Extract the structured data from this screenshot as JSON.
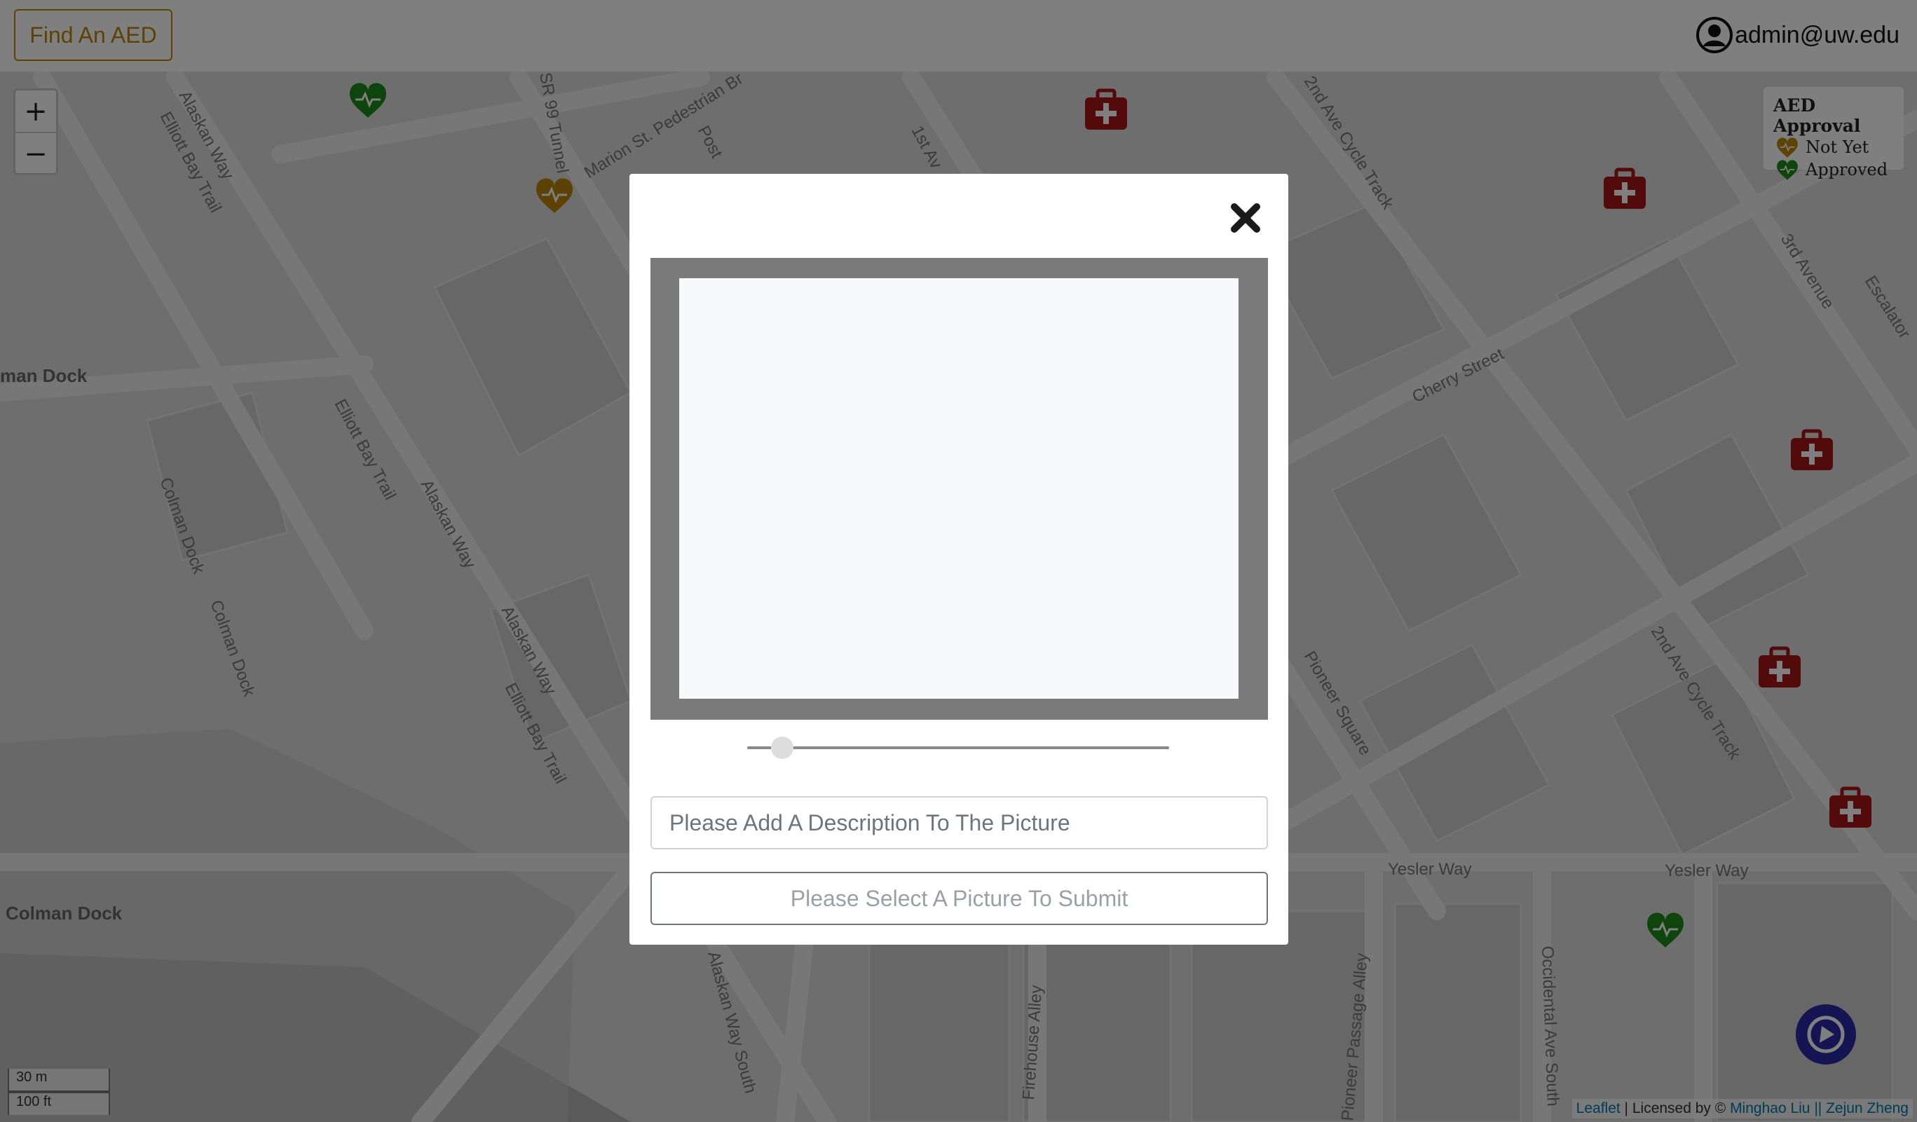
{
  "header": {
    "find_aed_label": "Find An AED",
    "user_email": "admin@uw.edu",
    "user_icon": "user-circle-icon"
  },
  "map": {
    "zoom_in_label": "+",
    "zoom_out_label": "−",
    "street_labels": [
      "Alaskan Way",
      "Elliott Bay Trail",
      "SR 99 Tunnel",
      "Marion St. Pedestrian Br",
      "Post",
      "1st Av",
      "2nd Ave Cycle Track",
      "3rd Avenue",
      "Escalator",
      "Cherry Street",
      "Colman Dock",
      "Yesler Way",
      "Pioneer Square",
      "Pioneer Passage Alley",
      "Occidental Ave South",
      "Firehouse Alley",
      "Alaskan Way South"
    ],
    "dock_labels": [
      "man Dock",
      "Colman Dock"
    ],
    "legend": {
      "title": "AED Approval",
      "items": [
        {
          "label": "Not Yet",
          "icon": "heart-pulse-icon",
          "color": "#b8860b"
        },
        {
          "label": "Approved",
          "icon": "heart-pulse-icon",
          "color": "#1a8a1a"
        }
      ]
    },
    "scale": {
      "metric": "30 m",
      "imperial": "100 ft"
    },
    "attribution": {
      "leaflet": "Leaflet",
      "separator": " | Licensed by © ",
      "author1": "Minghao Liu",
      "joiner": " || ",
      "author2": "Zejun Zheng"
    },
    "marker_colors": {
      "approved": "#1a8a1a",
      "not_yet": "#b8860b",
      "first_aid": "#a41515"
    }
  },
  "modal": {
    "close_icon": "close-icon",
    "slider_value": 0.06,
    "description_placeholder": "Please Add A Description To The Picture",
    "submit_label": "Please Select A Picture To Submit"
  }
}
